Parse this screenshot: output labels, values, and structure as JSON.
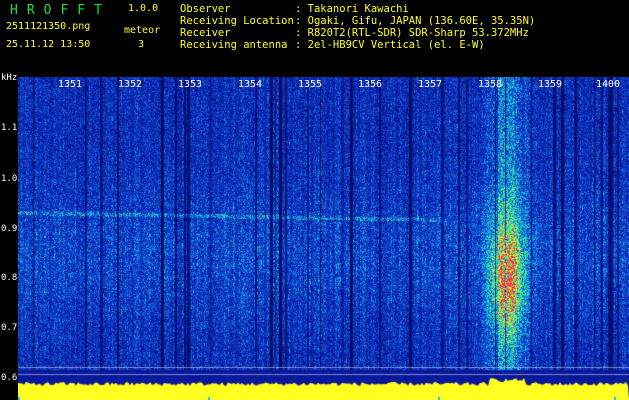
{
  "header": {
    "app_title": "HROFFT",
    "app_version": "1.0.0",
    "file_name": "2511121350.png",
    "timestamp": "25.11.12 13:50",
    "meteor_label": "meteor",
    "meteor_count": "3"
  },
  "info": {
    "observer_label": "Observer",
    "observer_value": ": Takanori Kawachi",
    "location_label": "Receiving Location",
    "location_value": ": Ogaki, Gifu, JAPAN (136.60E, 35.35N)",
    "receiver_label": "Receiver",
    "receiver_value": ": R820T2(RTL-SDR) SDR-Sharp 53.372MHz",
    "antenna_label": "Receiving antenna",
    "antenna_value": ": 2el-HB9CV Vertical (el. E-W)"
  },
  "spectrogram": {
    "ylabel": "kHz",
    "yticks": [
      "1.1",
      "1.0",
      "0.9",
      "0.8",
      "0.7",
      "0.6"
    ],
    "xticks": [
      "1351",
      "1352",
      "1353",
      "1354",
      "1355",
      "1356",
      "1357",
      "1358",
      "1359",
      "1400"
    ],
    "colors": {
      "background": "#0c1fb0",
      "deep": "#050a6a",
      "noise_cyan": "#16c6f0",
      "noise_green": "#2ff07a",
      "hot_yellow": "#f4f02a",
      "hot_red": "#ff2a4a",
      "floor": "#ffff22",
      "label_green": "#12e23c",
      "label_yellow": "#ffff24"
    }
  }
}
